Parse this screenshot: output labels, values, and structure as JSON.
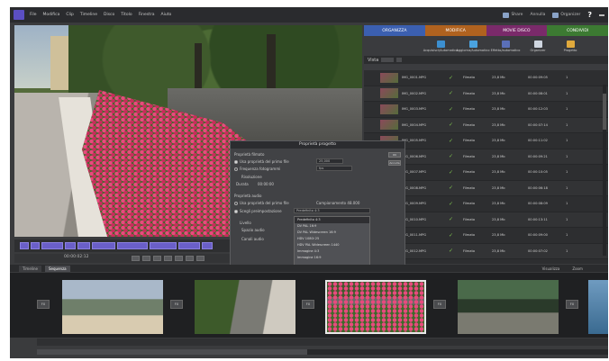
{
  "menubar": {
    "items": [
      "File",
      "Modifica",
      "Clip",
      "Timeline",
      "Disco",
      "Titolo",
      "Finestra",
      "Aiuto"
    ],
    "right": {
      "share_label": "Share",
      "undo_label": "Annulla",
      "organizer_label": "Organizer",
      "help_label": "?"
    }
  },
  "panel": {
    "tabs": [
      {
        "label": "ORGANIZZA",
        "color": "#3b5fb0"
      },
      {
        "label": "MODIFICA",
        "color": "#b0621f"
      },
      {
        "label": "MOVIE DISCO",
        "color": "#7a2a6a"
      },
      {
        "label": "CONDIVIDI",
        "color": "#3c7a32"
      }
    ],
    "tools": [
      {
        "label": "Acquisisci/Automatico",
        "icon": "capture-icon",
        "color": "#3c8fd0"
      },
      {
        "label": "Aggiorna/Automatico",
        "icon": "refresh-icon",
        "color": "#4aa3e0"
      },
      {
        "label": "Effetto/automatico",
        "icon": "effects-icon",
        "color": "#5a6fb8"
      },
      {
        "label": "Organizer",
        "icon": "organizer-icon",
        "color": "#cfd6e0"
      },
      {
        "label": "Progetto",
        "icon": "project-icon",
        "color": "#e0a93c"
      }
    ],
    "filter_label": "Vista",
    "rows": [
      {
        "name": "IMG_0001.MPG",
        "src": "Filmato",
        "size": "23,8 Mb",
        "dur": "00:00:09:05",
        "n": "1"
      },
      {
        "name": "IMG_0002.MPG",
        "src": "Filmato",
        "size": "23,8 Mb",
        "dur": "00:00:08:01",
        "n": "1"
      },
      {
        "name": "IMG_0003.MPG",
        "src": "Filmato",
        "size": "23,8 Mb",
        "dur": "00:00:12:03",
        "n": "1"
      },
      {
        "name": "IMG_0004.MPG",
        "src": "Filmato",
        "size": "23,8 Mb",
        "dur": "00:00:07:14",
        "n": "1"
      },
      {
        "name": "IMG_0005.MPG",
        "src": "Filmato",
        "size": "23,8 Mb",
        "dur": "00:00:11:02",
        "n": "1"
      },
      {
        "name": "IMG_0006.MPG",
        "src": "Filmato",
        "size": "23,8 Mb",
        "dur": "00:00:09:21",
        "n": "1"
      },
      {
        "name": "IMG_0007.MPG",
        "src": "Filmato",
        "size": "23,8 Mb",
        "dur": "00:00:10:05",
        "n": "1"
      },
      {
        "name": "IMG_0008.MPG",
        "src": "Filmato",
        "size": "23,8 Mb",
        "dur": "00:00:06:18",
        "n": "1"
      },
      {
        "name": "IMG_0009.MPG",
        "src": "Filmato",
        "size": "23,8 Mb",
        "dur": "00:00:08:09",
        "n": "1"
      },
      {
        "name": "IMG_0010.MPG",
        "src": "Filmato",
        "size": "23,8 Mb",
        "dur": "00:00:13:11",
        "n": "1"
      },
      {
        "name": "IMG_0011.MPG",
        "src": "Filmato",
        "size": "23,8 Mb",
        "dur": "00:00:09:00",
        "n": "1"
      },
      {
        "name": "IMG_0012.MPG",
        "src": "Filmato",
        "size": "23,8 Mb",
        "dur": "00:00:07:02",
        "n": "1"
      }
    ]
  },
  "dialog": {
    "title": "Proprietà progetto",
    "section1": "Proprietà filmato",
    "opt1": "Usa proprietà del primo file",
    "opt1_value": "25,000",
    "opt2": "Frequenza fotogrammi",
    "opt2_value": "fps",
    "field_a": "Risoluzione",
    "field_b": "Durata",
    "field_b_value": "00:00:00",
    "section2": "Proprietà audio",
    "opt3": "Usa proprietà del primo file",
    "opt3_value": "Campionamento 48.000",
    "opt4": "Scegli preimpostazione",
    "opt4_value": "Predefinito 4:3",
    "label_c": "Livello",
    "label_d": "Spazio audio",
    "label_e": "Canali audio",
    "dropdown": [
      "Predefinito 4:3",
      "DV PAL 16:9",
      "DV PAL Widescreen 16:9",
      "HDV 1080i 25",
      "HDV PAL Widescreen 1440",
      "Immagine 4:3",
      "Immagine 16:9"
    ],
    "ok": "OK",
    "cancel": "Annulla"
  },
  "transport": {
    "counter": "00:00:02:12"
  },
  "bottom": {
    "tabs": [
      "Timeline",
      "Sequenza"
    ],
    "right_labels": [
      "Visualizza",
      "Zoom"
    ],
    "transitions": [
      "FX",
      "FX",
      "FX",
      "FX",
      "FX"
    ]
  },
  "colors": {
    "accent": "#6a5fc8",
    "background": "#3a3b3d"
  }
}
